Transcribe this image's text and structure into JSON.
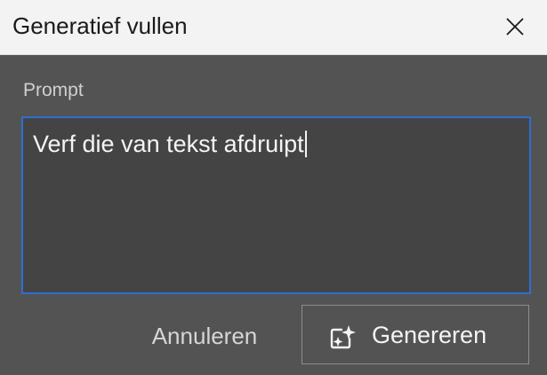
{
  "dialog": {
    "title": "Generatief vullen",
    "close_icon": "close-icon"
  },
  "prompt": {
    "label": "Prompt",
    "value": "Verf die van tekst afdruipt"
  },
  "actions": {
    "cancel_label": "Annuleren",
    "generate_label": "Genereren",
    "generate_icon": "generative-sparkle-icon"
  },
  "colors": {
    "focus_border": "#2f6fd1",
    "dialog_bg": "#535353",
    "title_bar_bg": "#f3f3f3"
  }
}
